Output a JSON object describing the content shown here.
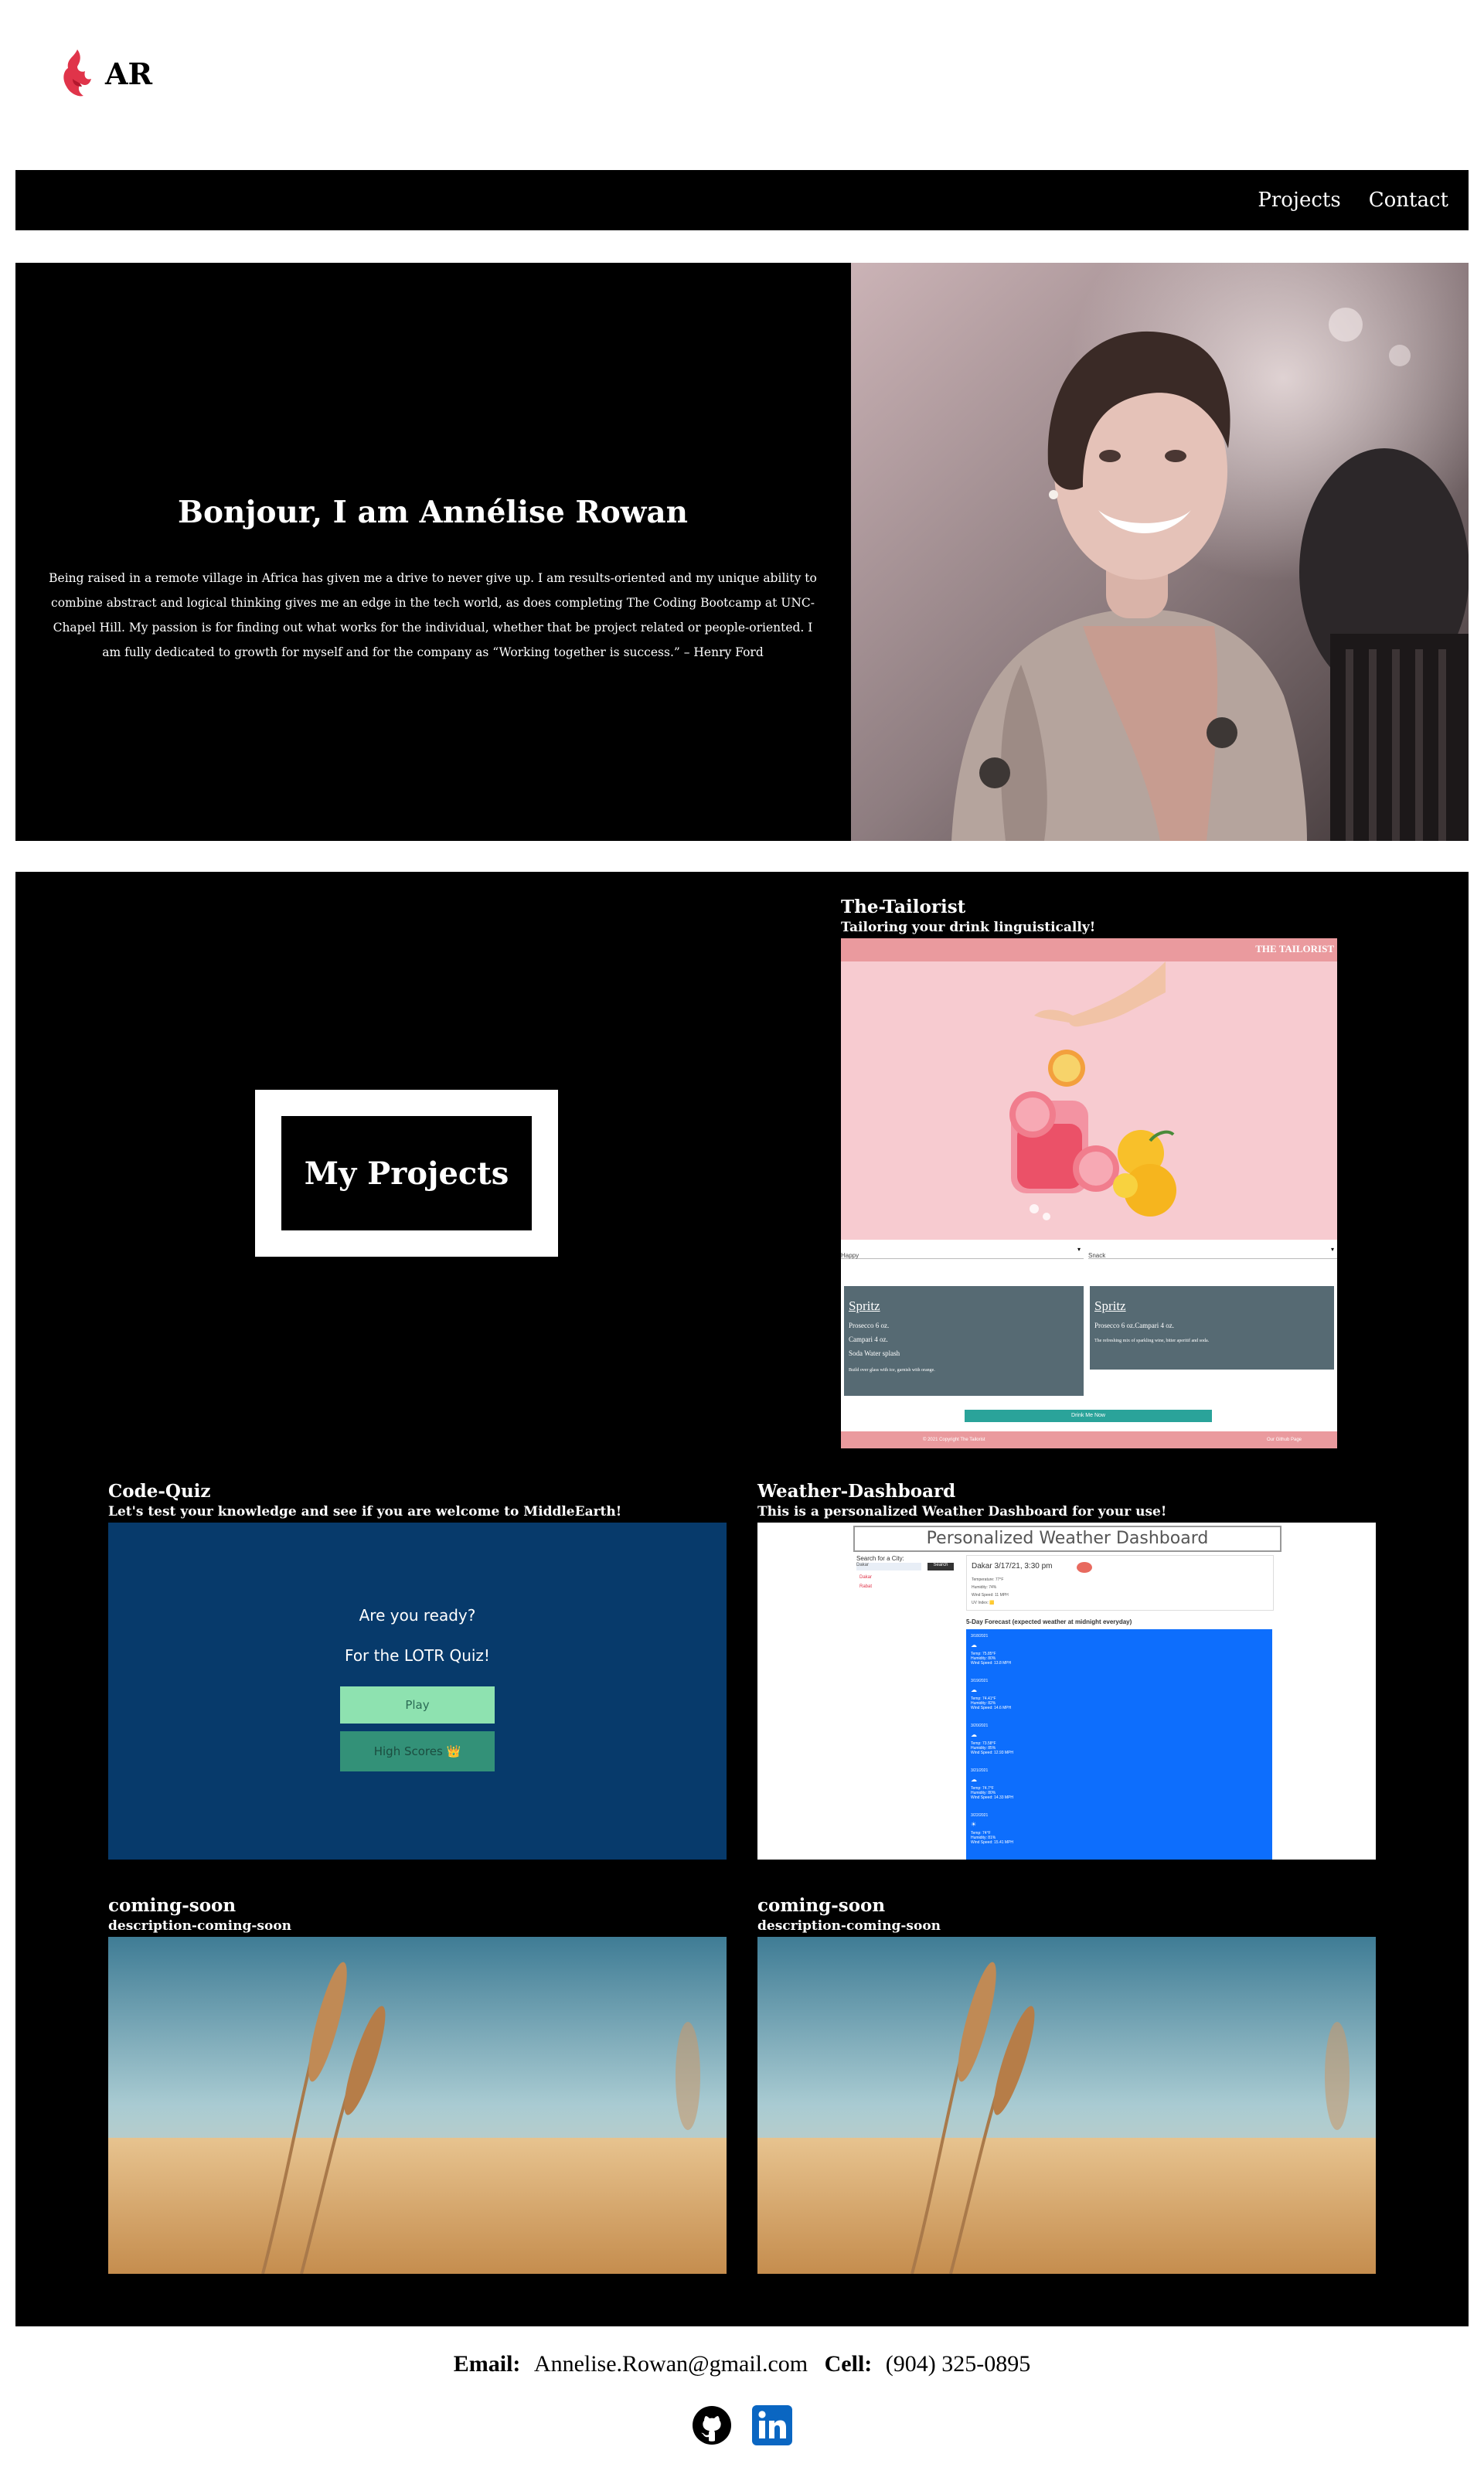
{
  "logo": {
    "text": "AR",
    "icon": "flame-logo-icon",
    "color": "#e0344a"
  },
  "nav": {
    "projects_label": "Projects",
    "contact_label": "Contact"
  },
  "hero": {
    "heading": "Bonjour, I am Annélise Rowan",
    "bio": "Being raised in a remote village in Africa has given me a drive to never give up. I am results-oriented and my unique ability to combine abstract and logical thinking gives me an edge in the tech world, as does completing The Coding Bootcamp at UNC- Chapel Hill. My passion is for finding out what works for the individual, whether that be project related or people-oriented. I am fully dedicated to growth for myself and for the company as “Working together is success.” – Henry Ford"
  },
  "projects": {
    "heading": "My Projects",
    "items": [
      {
        "title": "The-Tailorist",
        "description": "Tailoring your drink linguistically!",
        "screenshot": {
          "brand": "THE TAILORIST",
          "select_left": "Happy",
          "select_right": "Snack",
          "card_left": {
            "title": "Spritz",
            "lines": [
              "Prosecco 6 oz.",
              "Campari 4 oz.",
              "Soda Water splash"
            ],
            "note": "Build over glass with ice, garnish with orange."
          },
          "card_right": {
            "title": "Spritz",
            "lines": [
              "Prosecco 6 oz.Campari 4 oz."
            ],
            "note": "The refreshing mix of sparkling wine, bitter aperitif and soda."
          },
          "button": "Drink Me Now",
          "footer_left": "© 2021 Copyright The Tailorist",
          "footer_right": "Our Github Page"
        }
      },
      {
        "title": "Code-Quiz",
        "description": "Let's test your knowledge and see if you are welcome to MiddleEarth!",
        "screenshot": {
          "line1": "Are you ready?",
          "line2": "For the LOTR Quiz!",
          "play": "Play",
          "scores": "High Scores 👑"
        }
      },
      {
        "title": "Weather-Dashboard",
        "description": "This is a personalized Weather Dashboard for your use!",
        "screenshot": {
          "header": "Personalized Weather Dashboard",
          "search_label": "Search for a City:",
          "search_value": "Dakar",
          "search_button": "Search",
          "history": [
            "Dakar",
            "Rabat"
          ],
          "city_line": "Dakar 3/17/21, 3:30 pm",
          "current": [
            "Temperature: 77°F",
            "Humidity: 74%",
            "Wind Speed: 11 MPH",
            "UV Index: 🟨"
          ],
          "forecast_title": "5-Day Forecast (expected weather at midnight everyday)",
          "forecast": [
            {
              "date": "3/18/2021",
              "temp": "Temp: 75.85°F",
              "hum": "Humidity: 80%",
              "wind": "Wind Speed: 13.8 MPH"
            },
            {
              "date": "3/19/2021",
              "temp": "Temp: 74.41°F",
              "hum": "Humidity: 82%",
              "wind": "Wind Speed: 14.6 MPH"
            },
            {
              "date": "3/20/2021",
              "temp": "Temp: 73.58°F",
              "hum": "Humidity: 85%",
              "wind": "Wind Speed: 12.93 MPH"
            },
            {
              "date": "3/21/2021",
              "temp": "Temp: 74.7°F",
              "hum": "Humidity: 80%",
              "wind": "Wind Speed: 14.33 MPH"
            },
            {
              "date": "3/22/2021",
              "temp": "Temp: 74°F",
              "hum": "Humidity: 81%",
              "wind": "Wind Speed: 15.41 MPH"
            }
          ]
        }
      },
      {
        "title": "coming-soon",
        "description": "description-coming-soon"
      },
      {
        "title": "coming-soon",
        "description": "description-coming-soon"
      }
    ]
  },
  "footer": {
    "email_label": "Email:",
    "email": "Annelise.Rowan@gmail.com",
    "cell_label": "Cell:",
    "cell": "(904) 325-0895",
    "icons": [
      "github-icon",
      "linkedin-icon"
    ]
  },
  "colors": {
    "black": "#000000",
    "quiz_bg": "#073a6b",
    "quiz_play": "#8ee2b0",
    "quiz_scores": "#339178",
    "weather_forecast": "#0d6efd",
    "tailorist_pink": "#f7cbd0",
    "tailorist_card": "#566a73",
    "linkedin": "#0a66c2"
  }
}
